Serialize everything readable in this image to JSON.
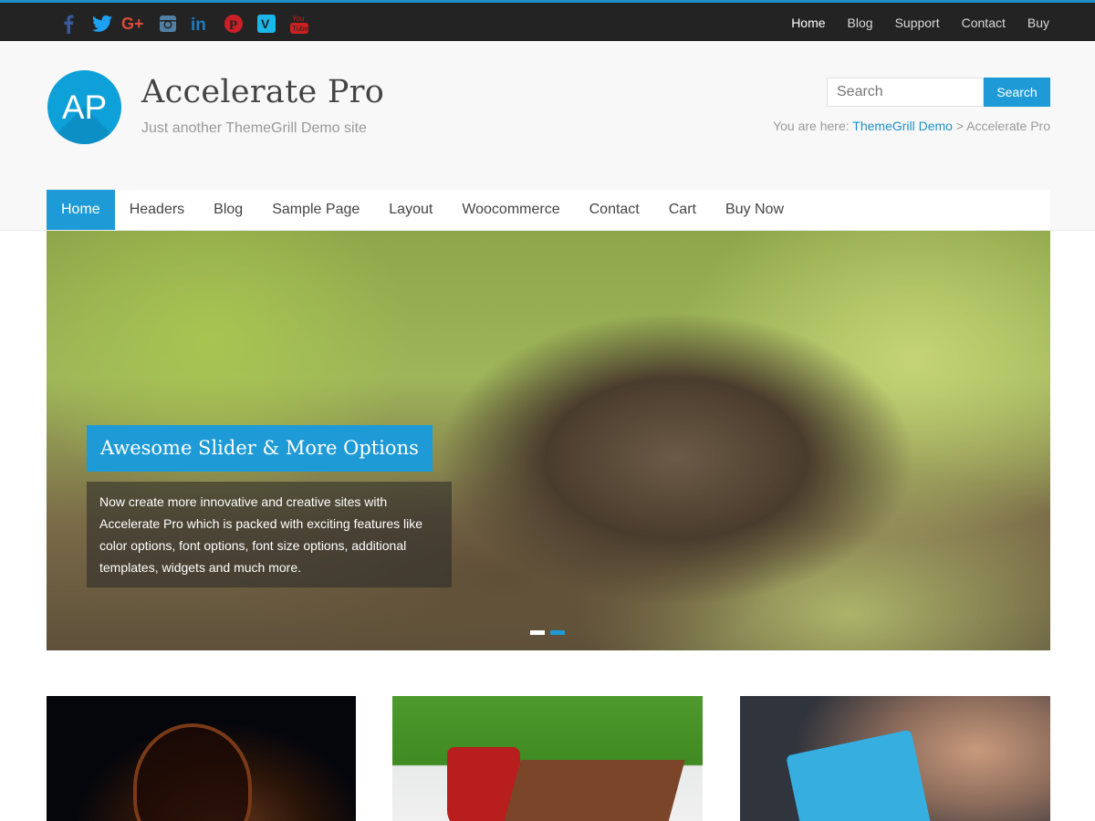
{
  "colors": {
    "accent": "#1e9bd6",
    "topbar": "#232323",
    "header_bg": "#f8f8f8"
  },
  "social": [
    {
      "name": "facebook-icon",
      "glyph": "f",
      "color": "#3b5998"
    },
    {
      "name": "twitter-icon",
      "glyph": "t",
      "color": "#1da1f2"
    },
    {
      "name": "google-plus-icon",
      "glyph": "G+",
      "color": "#dd4b39"
    },
    {
      "name": "instagram-icon",
      "glyph": "◙",
      "color": "#517fa4"
    },
    {
      "name": "linkedin-icon",
      "glyph": "in",
      "color": "#1f7bc1"
    },
    {
      "name": "pinterest-icon",
      "glyph": "P",
      "color": "#cb2027"
    },
    {
      "name": "vimeo-icon",
      "glyph": "V",
      "color": "#1ab7ea"
    },
    {
      "name": "youtube-icon",
      "glyph": "You Tube",
      "color": "#cd201f"
    }
  ],
  "topnav": {
    "items": [
      "Home",
      "Blog",
      "Support",
      "Contact",
      "Buy"
    ]
  },
  "header": {
    "logo_text": "AP",
    "title": "Accelerate Pro",
    "tagline": "Just another ThemeGrill Demo site",
    "search_placeholder": "Search",
    "search_button": "Search",
    "breadcrumb_prefix": "You are here: ",
    "breadcrumb_link": "ThemeGrill Demo",
    "breadcrumb_sep": " > ",
    "breadcrumb_current": "Accelerate Pro"
  },
  "mainnav": {
    "items": [
      "Home",
      "Headers",
      "Blog",
      "Sample Page",
      "Layout",
      "Woocommerce",
      "Contact",
      "Cart",
      "Buy Now"
    ]
  },
  "slider": {
    "title": "Awesome Slider & More Options",
    "description": "Now create more innovative and creative sites with Accelerate Pro which is packed with exciting features like color options, font options, font size options, additional templates, widgets and much more."
  }
}
